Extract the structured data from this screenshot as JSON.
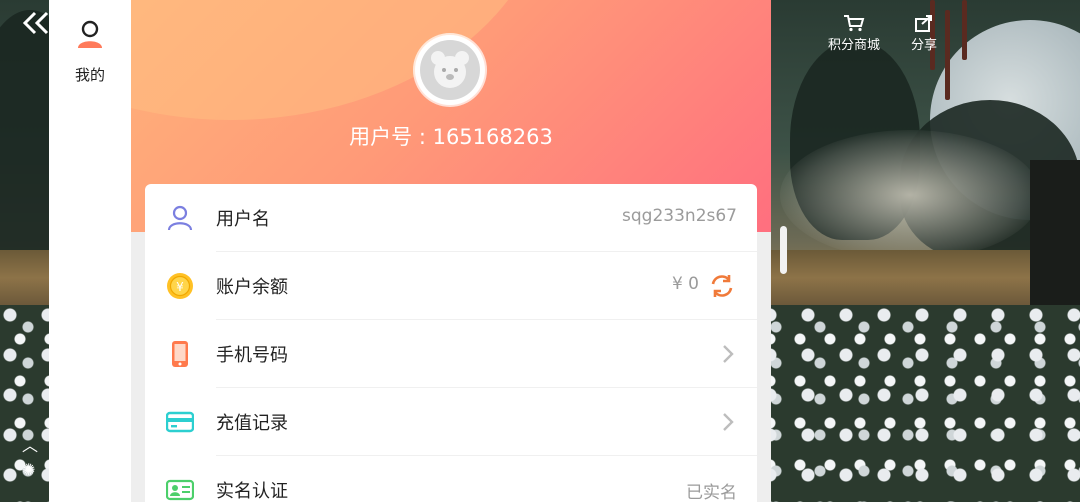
{
  "nav": {
    "back_icon": "back-arrow-icon",
    "tab_label": "我的",
    "tab_icon": "user-icon"
  },
  "top_actions": [
    {
      "label": "积分商城",
      "icon": "cart-icon"
    },
    {
      "label": "分享",
      "icon": "share-icon"
    }
  ],
  "profile": {
    "avatar_icon": "bear-avatar",
    "user_id_text": "用户号 : 165168263"
  },
  "rows": [
    {
      "label": "用户名",
      "value": "sqg233n2s67",
      "icon": "person-icon"
    },
    {
      "label": "账户余额",
      "value": "¥ 0",
      "icon": "coin-icon",
      "action_icon": "refresh-icon"
    },
    {
      "label": "手机号码",
      "value": "",
      "icon": "phone-icon",
      "action_icon": "chevron-right-icon"
    },
    {
      "label": "充值记录",
      "value": "",
      "icon": "card-icon",
      "action_icon": "chevron-right-icon"
    },
    {
      "label": "实名认证",
      "value": "已实名",
      "icon": "id-card-icon"
    }
  ],
  "colors": {
    "hero_start": "#ffb27a",
    "hero_end": "#ff6f7f",
    "accent_orange": "#f07a3a",
    "icon_purple": "#7b7fe0",
    "icon_cyan": "#2ccfd0",
    "icon_green": "#4ccf6a"
  }
}
